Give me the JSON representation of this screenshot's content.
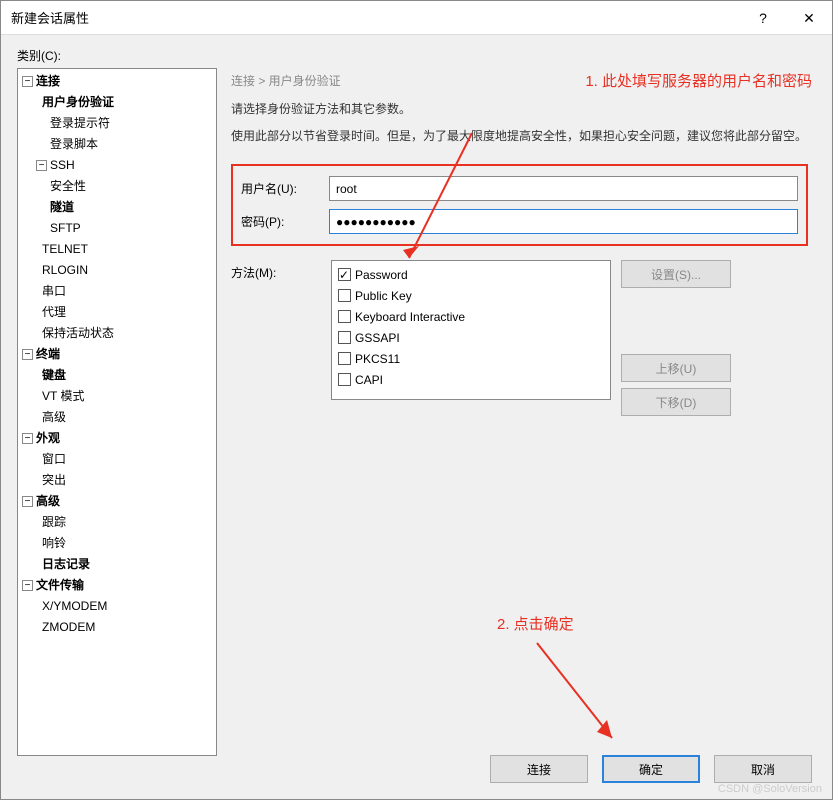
{
  "title": "新建会话属性",
  "help_icon": "?",
  "close_icon": "✕",
  "category_label": "类别(C):",
  "tree": {
    "conn": "连接",
    "auth": "用户身份验证",
    "login_prompt": "登录提示符",
    "login_script": "登录脚本",
    "ssh": "SSH",
    "security": "安全性",
    "tunnel": "隧道",
    "sftp": "SFTP",
    "telnet": "TELNET",
    "rlogin": "RLOGIN",
    "serial": "串口",
    "proxy": "代理",
    "keepalive": "保持活动状态",
    "terminal": "终端",
    "keyboard": "键盘",
    "vtmode": "VT 模式",
    "advanced": "高级",
    "appearance": "外观",
    "window": "窗口",
    "popup": "突出",
    "advanced2": "高级",
    "trace": "跟踪",
    "bell": "响铃",
    "log": "日志记录",
    "filetransfer": "文件传输",
    "xymodem": "X/YMODEM",
    "zmodem": "ZMODEM"
  },
  "breadcrumb": "连接 > 用户身份验证",
  "desc1": "请选择身份验证方法和其它参数。",
  "desc2": "使用此部分以节省登录时间。但是，为了最大限度地提高安全性，如果担心安全问题，建议您将此部分留空。",
  "form": {
    "username_label": "用户名(U):",
    "username_value": "root",
    "password_label": "密码(P):",
    "password_value": "●●●●●●●●●●●"
  },
  "method_label": "方法(M):",
  "methods": [
    {
      "label": "Password",
      "checked": true
    },
    {
      "label": "Public Key",
      "checked": false
    },
    {
      "label": "Keyboard Interactive",
      "checked": false
    },
    {
      "label": "GSSAPI",
      "checked": false
    },
    {
      "label": "PKCS11",
      "checked": false
    },
    {
      "label": "CAPI",
      "checked": false
    }
  ],
  "buttons": {
    "settings": "设置(S)...",
    "moveup": "上移(U)",
    "movedown": "下移(D)",
    "connect": "连接",
    "ok": "确定",
    "cancel": "取消"
  },
  "annotations": {
    "a1": "1. 此处填写服务器的用户名和密码",
    "a2": "2. 点击确定"
  },
  "watermark": "CSDN @SoloVersion"
}
